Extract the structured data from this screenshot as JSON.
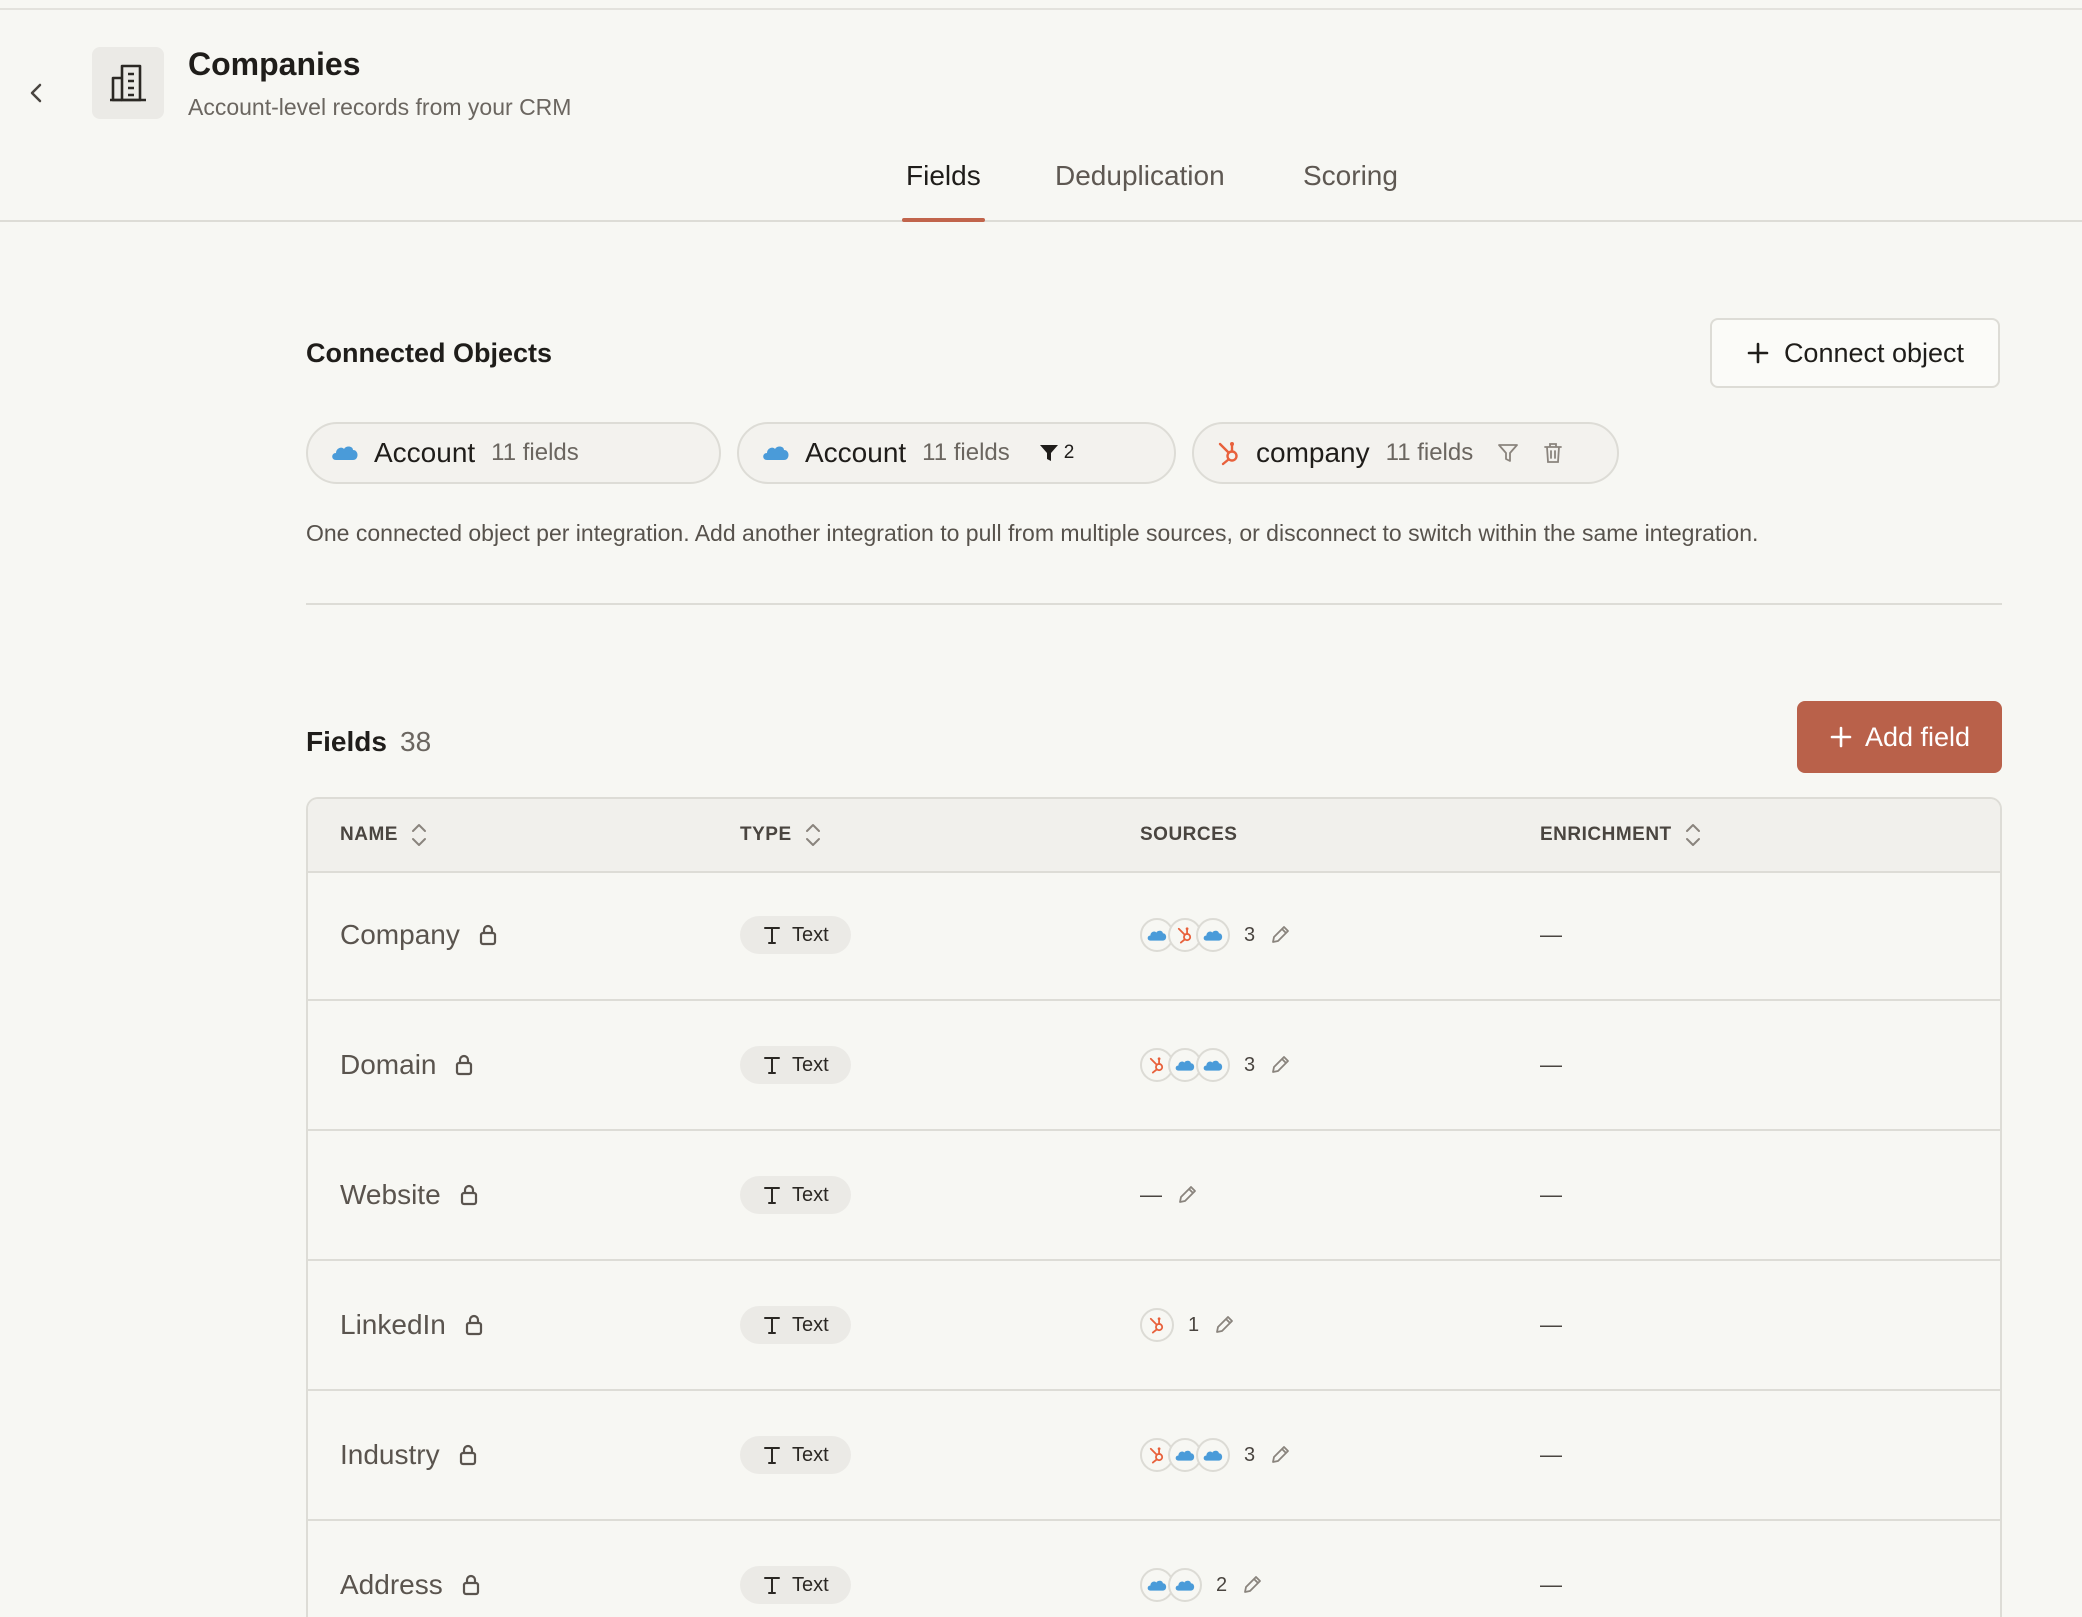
{
  "header": {
    "title": "Companies",
    "subtitle": "Account-level records from your CRM"
  },
  "tabs": [
    {
      "label": "Fields",
      "active": true
    },
    {
      "label": "Deduplication",
      "active": false
    },
    {
      "label": "Scoring",
      "active": false
    }
  ],
  "connected": {
    "title": "Connected Objects",
    "connect_label": "Connect object",
    "chips": [
      {
        "integration": "salesforce",
        "name": "Account",
        "count": "11 fields"
      },
      {
        "integration": "salesforce",
        "name": "Account",
        "count": "11 fields",
        "filter_count": "2"
      },
      {
        "integration": "hubspot",
        "name": "company",
        "count": "11 fields"
      }
    ],
    "note": "One connected object per integration. Add another integration to pull from multiple sources, or disconnect to switch within the same integration."
  },
  "fields": {
    "title": "Fields",
    "count": "38",
    "add_label": "Add field",
    "columns": {
      "name": "NAME",
      "type": "TYPE",
      "sources": "SOURCES",
      "enrichment": "ENRICHMENT"
    },
    "rows": [
      {
        "name": "Company",
        "type": "Text",
        "sources": [
          "salesforce",
          "hubspot",
          "salesforce"
        ],
        "source_count": "3",
        "enrichment": "—"
      },
      {
        "name": "Domain",
        "type": "Text",
        "sources": [
          "hubspot",
          "salesforce",
          "salesforce"
        ],
        "source_count": "3",
        "enrichment": "—"
      },
      {
        "name": "Website",
        "type": "Text",
        "sources": [],
        "source_count": "—",
        "enrichment": "—"
      },
      {
        "name": "LinkedIn",
        "type": "Text",
        "sources": [
          "hubspot"
        ],
        "source_count": "1",
        "enrichment": "—"
      },
      {
        "name": "Industry",
        "type": "Text",
        "sources": [
          "hubspot",
          "salesforce",
          "salesforce"
        ],
        "source_count": "3",
        "enrichment": "—"
      },
      {
        "name": "Address",
        "type": "Text",
        "sources": [
          "salesforce",
          "salesforce"
        ],
        "source_count": "2",
        "enrichment": "—"
      }
    ]
  },
  "colors": {
    "accent": "#b9614a",
    "tab_underline": "#c1644b",
    "salesforce": "#4a9bd9",
    "hubspot": "#e8613c"
  }
}
